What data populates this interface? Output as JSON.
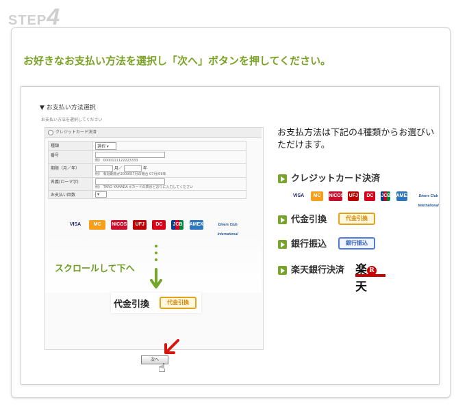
{
  "step": {
    "word": "STEP",
    "number": "4"
  },
  "headline": "お好きなお支払い方法を選択し「次へ」ボタンを押してください。",
  "mini_form": {
    "title": "▼ お支払い方法選択",
    "subtitle": "お支払い方法を選択してください",
    "radio_label": "クレジットカード決済",
    "rows": [
      {
        "label": "種類",
        "select": "選択"
      },
      {
        "label": "番号",
        "hint": "例） 0000111122223333"
      },
      {
        "label": "期限（月／年）",
        "month": "月／",
        "year": "年",
        "hint": "例） 有効期限が2009年7月の場合 07月/09年"
      },
      {
        "label": "名義(ローマ字)",
        "hint": "例） TARO YAMADA ※カードの表示どおりに入力してください"
      },
      {
        "label": "お支払い回数"
      }
    ]
  },
  "scroll_text": "スクロールして下へ",
  "daikin_label": "代金引換",
  "daikin_badge": "代金引換",
  "next_button": "次へ",
  "info_title": "お支払方法は下記の4種類からお選びいただけます。",
  "methods": [
    {
      "label": "クレジットカード決済"
    },
    {
      "label": "代金引換",
      "badge": "代金引換"
    },
    {
      "label": "銀行振込",
      "badge": "銀行振込"
    },
    {
      "label": "楽天銀行決済"
    }
  ],
  "card_brands": [
    "VISA",
    "MC",
    "NICOS",
    "UFJ",
    "DC",
    "JCB",
    "AMEX",
    "Diners Club International"
  ],
  "rakuten": {
    "left": "楽",
    "mark": "R",
    "right": "天"
  },
  "colors": {
    "accent_green": "#77a52a",
    "badge_orange": "#e5a11b",
    "badge_blue": "#4f7bd6",
    "red_arrow": "#d9140c"
  }
}
